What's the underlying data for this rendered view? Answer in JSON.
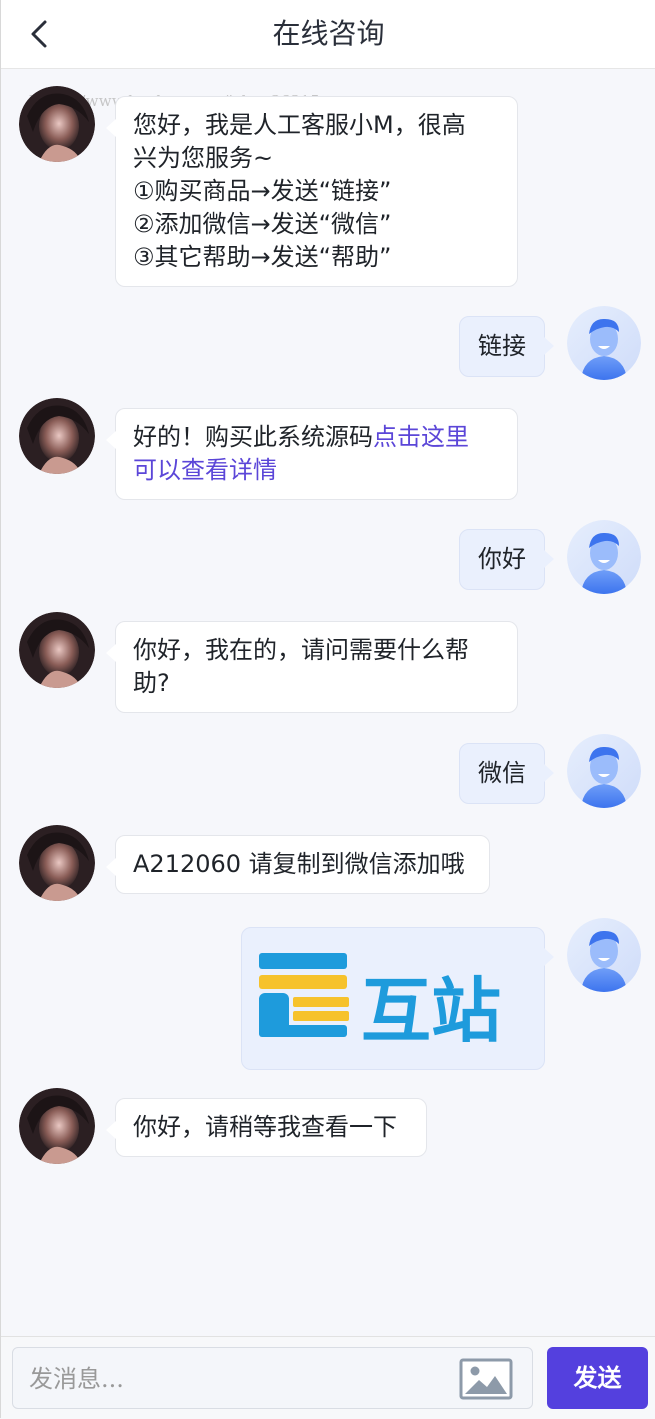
{
  "header": {
    "title": "在线咨询"
  },
  "watermark": "https://www.huzhan.com/ishop36315",
  "messages": [
    {
      "from": "agent",
      "lines": [
        "您好，我是人工客服小M，很高",
        "兴为您服务~",
        "①购买商品→发送“链接”",
        "②添加微信→发送“微信”",
        "③其它帮助→发送“帮助”"
      ]
    },
    {
      "from": "user",
      "text": "链接"
    },
    {
      "from": "agent",
      "text_before": "好的！购买此系统源码",
      "link_line1": "点击这里",
      "link_line2": "可以查看详情"
    },
    {
      "from": "user",
      "text": "你好"
    },
    {
      "from": "agent",
      "lines": [
        "你好，我在的，请问需要什么帮",
        "助?"
      ]
    },
    {
      "from": "user",
      "text": "微信"
    },
    {
      "from": "agent",
      "text": "A212060 请复制到微信添加哦"
    },
    {
      "from": "user",
      "image_text": "互站"
    },
    {
      "from": "agent",
      "text": "你好，请稍等我查看一下"
    }
  ],
  "composer": {
    "placeholder": "发消息...",
    "send_label": "发送"
  },
  "icons": {
    "back": "chevron-left-icon",
    "image": "image-icon"
  },
  "colors": {
    "accent": "#5440de",
    "link": "#5b46d8",
    "user_bubble": "#eaf0fd"
  }
}
